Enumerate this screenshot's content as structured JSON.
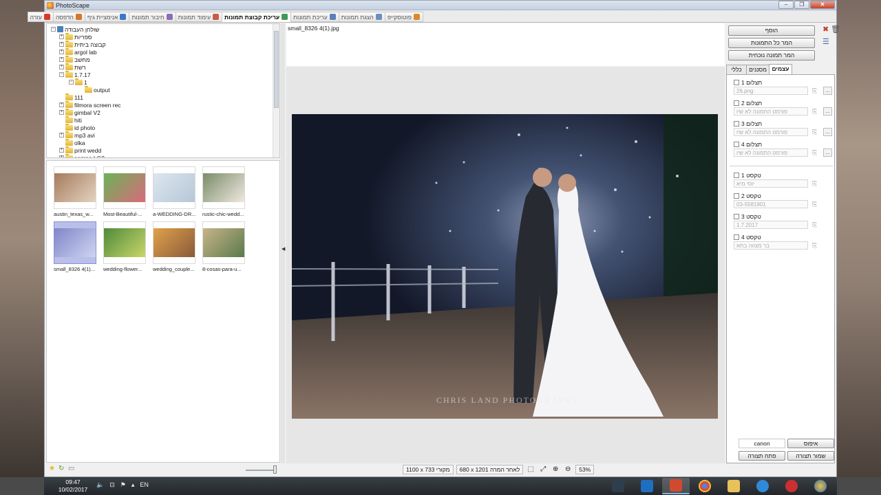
{
  "app": {
    "title": "PhotoScape"
  },
  "tabs": [
    {
      "label": "פוטוסקייפ",
      "icon": "photoscape-icon",
      "color": "#d98a2b"
    },
    {
      "label": "הצגת תמונות",
      "icon": "viewer-icon",
      "color": "#6c8fbf"
    },
    {
      "label": "עריכת תמונות",
      "icon": "editor-icon",
      "color": "#5b7fb8"
    },
    {
      "label": "עריכת קבוצת תמונות",
      "icon": "batch-editor-icon",
      "color": "#3f9a56",
      "active": true
    },
    {
      "label": "עימוד תמונות",
      "icon": "page-icon",
      "color": "#c85b4a"
    },
    {
      "label": "חיבור תמונות",
      "icon": "combine-icon",
      "color": "#8a6fb8"
    },
    {
      "label": "אנימציית גיף",
      "icon": "gif-icon",
      "color": "#3c78c8"
    },
    {
      "label": "הדפסה",
      "icon": "print-icon",
      "color": "#d4762c"
    },
    {
      "label": "עזרה",
      "icon": "help-icon",
      "color": "#d43a2a"
    }
  ],
  "tree": {
    "root": "שולחן העבודה",
    "items": [
      {
        "label": "ספריות",
        "type": "libraries"
      },
      {
        "label": "קבוצה ביתית",
        "type": "homegroup"
      },
      {
        "label": "argol lab",
        "type": "user"
      },
      {
        "label": "מחשב",
        "type": "computer"
      },
      {
        "label": "רשת",
        "type": "network"
      },
      {
        "label": "1.7.17",
        "type": "folder"
      },
      {
        "label": "1",
        "type": "folder"
      },
      {
        "label": "output",
        "type": "folder"
      },
      {
        "label": "111",
        "type": "folder"
      },
      {
        "label": "filmora screen rec",
        "type": "folder"
      },
      {
        "label": "gimbal V2",
        "type": "folder"
      },
      {
        "label": "hiti",
        "type": "folder"
      },
      {
        "label": "id photo",
        "type": "folder"
      },
      {
        "label": "mp3 avi",
        "type": "folder"
      },
      {
        "label": "olka",
        "type": "folder"
      },
      {
        "label": "print wedd",
        "type": "folder"
      },
      {
        "label": "sampo LG2",
        "type": "folder"
      }
    ]
  },
  "thumbnails": [
    {
      "caption": "austin_texas_w..."
    },
    {
      "caption": "Most-Beautiful-..."
    },
    {
      "caption": "a-WEDDING-DR..."
    },
    {
      "caption": "rustic-chic-wedd..."
    },
    {
      "caption": "small_8326 4(1)...",
      "selected": true
    },
    {
      "caption": "wedding-flower..."
    },
    {
      "caption": "wedding_couple..."
    },
    {
      "caption": "8-cosas-para-u..."
    }
  ],
  "preview": {
    "filename": "small_8326 4(1).jpg",
    "watermark": "CHRIS LAND PHOTOGRAPHY"
  },
  "status": {
    "original": "1100 x 733 מקורי",
    "resized": "680 x 1201 לאחר המרה",
    "zoom": "53%"
  },
  "right": {
    "add": "הוסף",
    "convert_all": "המר כל התמונות",
    "convert_current": "המר תמונה נוכחית",
    "tabs": {
      "general": "כללי",
      "filters": "מסננים",
      "objects": "עצמים"
    },
    "images": [
      {
        "label": "תצלום 1",
        "value": "26.png"
      },
      {
        "label": "תצלום 2",
        "value": "פורמט התמונה לא שיו"
      },
      {
        "label": "תצלום 3",
        "value": "פורמט התמונה לא שיו"
      },
      {
        "label": "תצלום 4",
        "value": "פורמט התמונה לא שיו"
      }
    ],
    "texts": [
      {
        "label": "טקסט 1",
        "value": "יוסי מיא"
      },
      {
        "label": "טקסט 2",
        "value": "03-5581901"
      },
      {
        "label": "טקסט 3",
        "value": "1.7.2017"
      },
      {
        "label": "טקסט 4",
        "value": "בר מצווה בתא"
      }
    ],
    "preset_value": "canon",
    "load": "איפוס",
    "open_preset": "פתח תצורה",
    "save_preset": "שמור תצורה"
  },
  "taskbar": {
    "time": "09:47",
    "date": "10/02/2017",
    "lang": "EN"
  }
}
